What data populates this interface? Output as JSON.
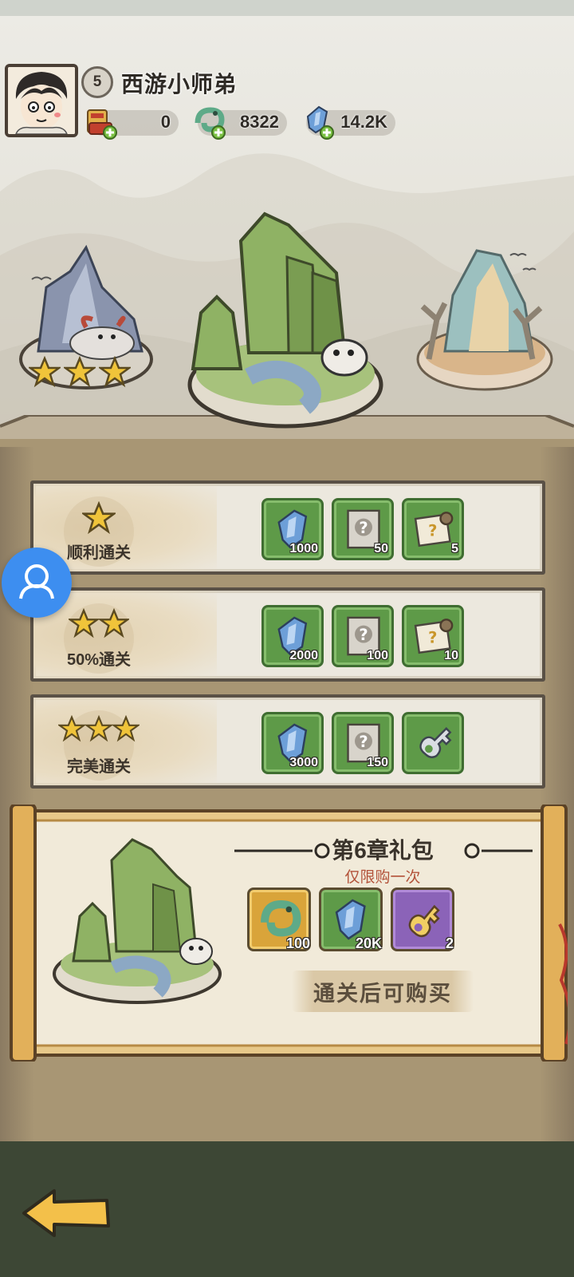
{
  "player": {
    "level": "5",
    "name": "西游小师弟"
  },
  "resources": [
    {
      "icon": "scroll-ticket-icon",
      "value": "0"
    },
    {
      "icon": "jade-dragon-icon",
      "value": "8322"
    },
    {
      "icon": "blue-crystal-icon",
      "value": "14.2K"
    }
  ],
  "stages": {
    "left_stars": 3,
    "center": "current-stage",
    "right": "next-stage"
  },
  "reward_rows": [
    {
      "label": "顺利通关",
      "stars": 1,
      "rewards": [
        {
          "icon": "blue-crystal-icon",
          "count": "1000"
        },
        {
          "icon": "mystery-card-icon",
          "count": "50"
        },
        {
          "icon": "mystery-scroll-icon",
          "count": "5"
        }
      ]
    },
    {
      "label": "50%通关",
      "stars": 2,
      "rewards": [
        {
          "icon": "blue-crystal-icon",
          "count": "2000"
        },
        {
          "icon": "mystery-card-icon",
          "count": "100"
        },
        {
          "icon": "mystery-scroll-icon",
          "count": "10"
        }
      ]
    },
    {
      "label": "完美通关",
      "stars": 3,
      "rewards": [
        {
          "icon": "blue-crystal-icon",
          "count": "3000"
        },
        {
          "icon": "mystery-card-icon",
          "count": "150"
        },
        {
          "icon": "silver-key-icon",
          "count": ""
        }
      ]
    }
  ],
  "gift": {
    "title": "第6章礼包",
    "subtitle": "仅限购一次",
    "items": [
      {
        "icon": "jade-dragon-icon",
        "count": "100",
        "color": "#d9a43a"
      },
      {
        "icon": "blue-crystal-icon",
        "count": "20K",
        "color": "#5e9a48"
      },
      {
        "icon": "gold-key-icon",
        "count": "2",
        "color": "#8b63b8"
      }
    ],
    "button": "通关后可购买"
  },
  "colors": {
    "reward_green": "#5e9a48",
    "gold_item": "#d9a43a",
    "purple_item": "#8b63b8",
    "bottom_bar": "#3d4735",
    "float_button": "#3d8ef0"
  }
}
